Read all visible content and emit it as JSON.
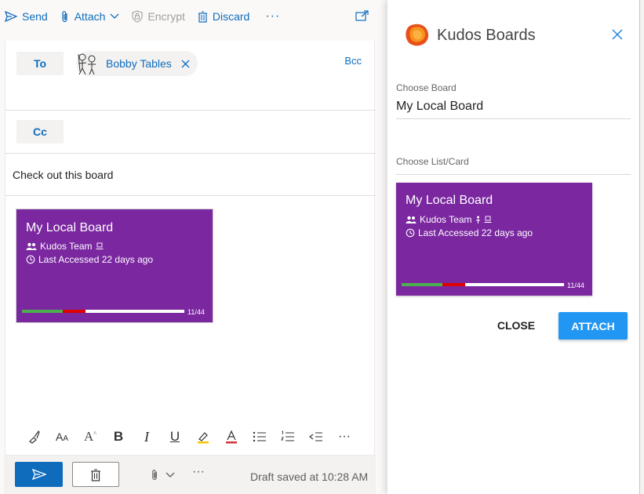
{
  "toolbar": {
    "send": "Send",
    "attach": "Attach",
    "encrypt": "Encrypt",
    "discard": "Discard",
    "more": "···"
  },
  "compose": {
    "to_label": "To",
    "cc_label": "Cc",
    "bcc_label": "Bcc",
    "recipient": "Bobby Tables",
    "subject": "Check out this board",
    "draft_status": "Draft saved at 10:28 AM",
    "more": "···"
  },
  "board_card": {
    "title": "My Local Board",
    "team": "Kudos Team",
    "last_accessed": "Last Accessed 22 days ago",
    "count": "11/44",
    "progress": {
      "green": 0.25,
      "red": 0.14
    },
    "color": "#7a27a0"
  },
  "panel": {
    "title": "Kudos Boards",
    "choose_board_label": "Choose Board",
    "choose_board_value": "My Local Board",
    "choose_list_label": "Choose List/Card",
    "close_button": "CLOSE",
    "attach_button": "ATTACH"
  },
  "colors": {
    "accent": "#0f6cbd",
    "attach_button": "#2196f3",
    "progress_green": "#4caf50",
    "progress_red": "#e10000"
  },
  "icons": {
    "send": "send-icon",
    "attach": "paperclip-icon",
    "encrypt": "lock-icon",
    "discard": "trash-icon",
    "popout": "popout-icon",
    "close": "close-icon",
    "team": "people-icon",
    "clock": "clock-icon"
  }
}
